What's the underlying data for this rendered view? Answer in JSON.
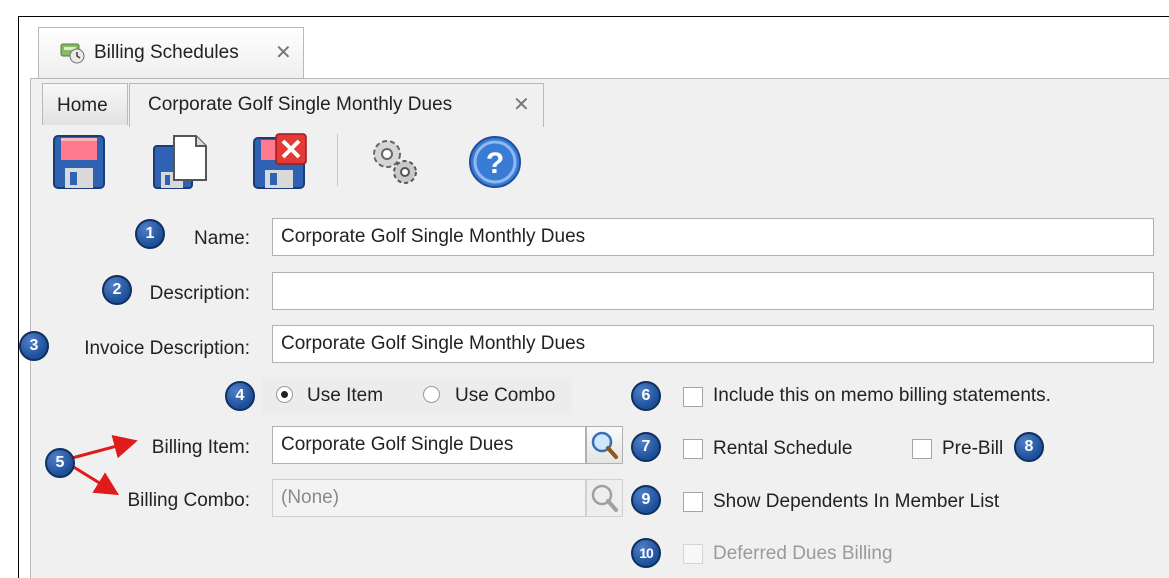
{
  "window_tab": {
    "title": "Billing Schedules",
    "close": "✕",
    "icon": "billing-schedule-icon"
  },
  "doc_tabs": {
    "home": "Home",
    "active": "Corporate Golf Single Monthly Dues",
    "close": "✕"
  },
  "toolbar": {
    "buttons": [
      "save-icon",
      "save-new-icon",
      "delete-icon",
      "settings-icon",
      "help-icon"
    ],
    "help_glyph": "?"
  },
  "form": {
    "name_label": "Name:",
    "name_value": "Corporate Golf Single Monthly Dues",
    "description_label": "Description:",
    "description_value": "",
    "invoice_description_label": "Invoice Description:",
    "invoice_description_value": "Corporate Golf Single Monthly Dues",
    "use_item_label": "Use Item",
    "use_combo_label": "Use Combo",
    "use_item_selected": true,
    "billing_item_label": "Billing Item:",
    "billing_item_value": "Corporate Golf Single Dues",
    "billing_combo_label": "Billing Combo:",
    "billing_combo_value": "(None)",
    "include_memo_label": "Include this on memo billing statements.",
    "rental_schedule_label": "Rental Schedule",
    "pre_bill_label": "Pre-Bill",
    "show_dependents_label": "Show Dependents In Member List",
    "deferred_dues_label": "Deferred Dues Billing"
  },
  "badges": [
    "1",
    "2",
    "3",
    "4",
    "5",
    "6",
    "7",
    "8",
    "9",
    "10"
  ],
  "colors": {
    "badge": "#1c4f99",
    "arrow": "#e01b1b",
    "panel": "#f0f0f0"
  }
}
